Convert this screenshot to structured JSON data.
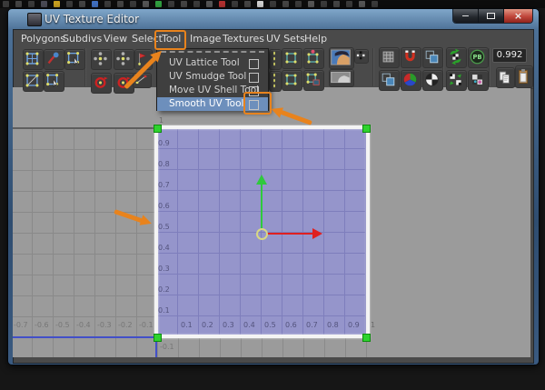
{
  "window": {
    "title": "UV Texture Editor",
    "controls": {
      "minimize": "−",
      "maximize": "",
      "close": "×"
    }
  },
  "menubar": {
    "items": [
      "Polygons",
      "Subdivs",
      "View",
      "Select",
      "Tool",
      "Image",
      "Textures",
      "UV Sets",
      "Help"
    ],
    "highlighted_item": "Tool"
  },
  "tool_menu": {
    "items": [
      {
        "label": "UV Lattice Tool",
        "checked": false,
        "selected": false
      },
      {
        "label": "UV Smudge Tool",
        "checked": false,
        "selected": false
      },
      {
        "label": "Move UV Shell Tool",
        "checked": false,
        "selected": false
      },
      {
        "label": "Smooth UV Tool",
        "checked": false,
        "selected": true
      }
    ]
  },
  "toolbar": {
    "value_field": "0.992",
    "icons": [
      {
        "name": "uv-move-component-icon",
        "shape": "grid-dots"
      },
      {
        "name": "uv-smudge-brush-icon",
        "shape": "brush"
      },
      {
        "name": "move-uv-shell-icon",
        "shape": "grid-cursor"
      },
      {
        "name": "uv-lattice-icon",
        "shape": "grid-diag"
      },
      {
        "name": "uv-select-shell-icon",
        "shape": "grid-cursor"
      },
      {
        "name": "flip-u-icon",
        "shape": "dots-cross"
      },
      {
        "name": "flip-v-icon",
        "shape": "dots-cross"
      },
      {
        "name": "rotate-ccw-icon",
        "shape": "rotate"
      },
      {
        "name": "rotate-cw-icon",
        "shape": "rotate"
      },
      {
        "name": "cut-uv-edge-icon",
        "shape": "flag"
      },
      {
        "name": "sew-uv-edge-icon",
        "shape": "diag"
      },
      {
        "name": "align-u-dots-icon",
        "shape": "dots-col"
      },
      {
        "name": "align-v-dots-icon",
        "shape": "dots-col"
      },
      {
        "name": "align-uv-min-icon",
        "shape": "square-dots"
      },
      {
        "name": "align-uv-max-icon",
        "shape": "square-dots-red"
      },
      {
        "name": "layout-uv-icon",
        "shape": "square-dots"
      },
      {
        "name": "layout-uv-shell-icon",
        "shape": "square-dots-tag"
      },
      {
        "name": "display-image-icon",
        "shape": "face-img"
      },
      {
        "name": "dim-image-icon",
        "shape": "bw-dots"
      },
      {
        "name": "filtered-image-icon",
        "shape": "face-gray"
      },
      {
        "name": "grid-icon",
        "shape": "grid-gray"
      },
      {
        "name": "pixel-snap-icon",
        "shape": "magnet"
      },
      {
        "name": "shade-uvs-icon",
        "shape": "overlap-squares"
      },
      {
        "name": "texture-borders-icon",
        "shape": "overlap-squares"
      },
      {
        "name": "rgb-channels-icon",
        "shape": "rgb-circle"
      },
      {
        "name": "alpha-channels-icon",
        "shape": "bw-pie"
      },
      {
        "name": "update-psd-icon",
        "shape": "dice-recycle"
      },
      {
        "name": "swap-buffer-icon",
        "shape": "dice-swap"
      },
      {
        "name": "paint-buffer-icon",
        "shape": "pb-badge"
      },
      {
        "name": "bake-texture-icon",
        "shape": "checker-sparkle"
      },
      {
        "name": "copy-icon",
        "shape": "copy-doc"
      },
      {
        "name": "paste-icon",
        "shape": "paste-clip"
      }
    ]
  },
  "canvas": {
    "x_axis_labels_negative": [
      "-0.7",
      "-0.6",
      "-0.5",
      "-0.4",
      "-0.3",
      "-0.2",
      "-0.1"
    ],
    "x_axis_labels_positive": [
      "0.1",
      "0.2",
      "0.3",
      "0.4",
      "0.5",
      "0.6",
      "0.7",
      "0.8",
      "0.9"
    ],
    "x_axis_label_one": "1",
    "y_axis_label_one": "1",
    "y_axis_labels": [
      "0.9",
      "0.8",
      "0.7",
      "0.6",
      "0.5",
      "0.4",
      "0.3",
      "0.2",
      "0.1"
    ],
    "y_axis_label_below_origin": "-0.1",
    "colors": {
      "uv_shell_fill": "#9595cb",
      "uv_shell_grid_line": "#7e7ebc",
      "canvas_background": "#9b9b9b",
      "canvas_grid_line": "#898989",
      "axis_zero_line_blue": "#4250c8",
      "shell_border_white": "#f4f4f4",
      "selection_handle_green": "#2ed32e",
      "manipulator_u_red": "#e02020",
      "manipulator_v_green": "#2fc93d",
      "annotation_orange": "#e8831d"
    }
  },
  "annotations": {
    "boxes": [
      {
        "name": "highlight-box-tool-menu"
      },
      {
        "name": "highlight-box-smooth-uv-checkbox"
      }
    ],
    "arrows": [
      {
        "name": "arrow-to-tool-menu"
      },
      {
        "name": "arrow-to-smooth-uv-checkbox"
      },
      {
        "name": "arrow-to-uv-shell-edge"
      }
    ]
  }
}
